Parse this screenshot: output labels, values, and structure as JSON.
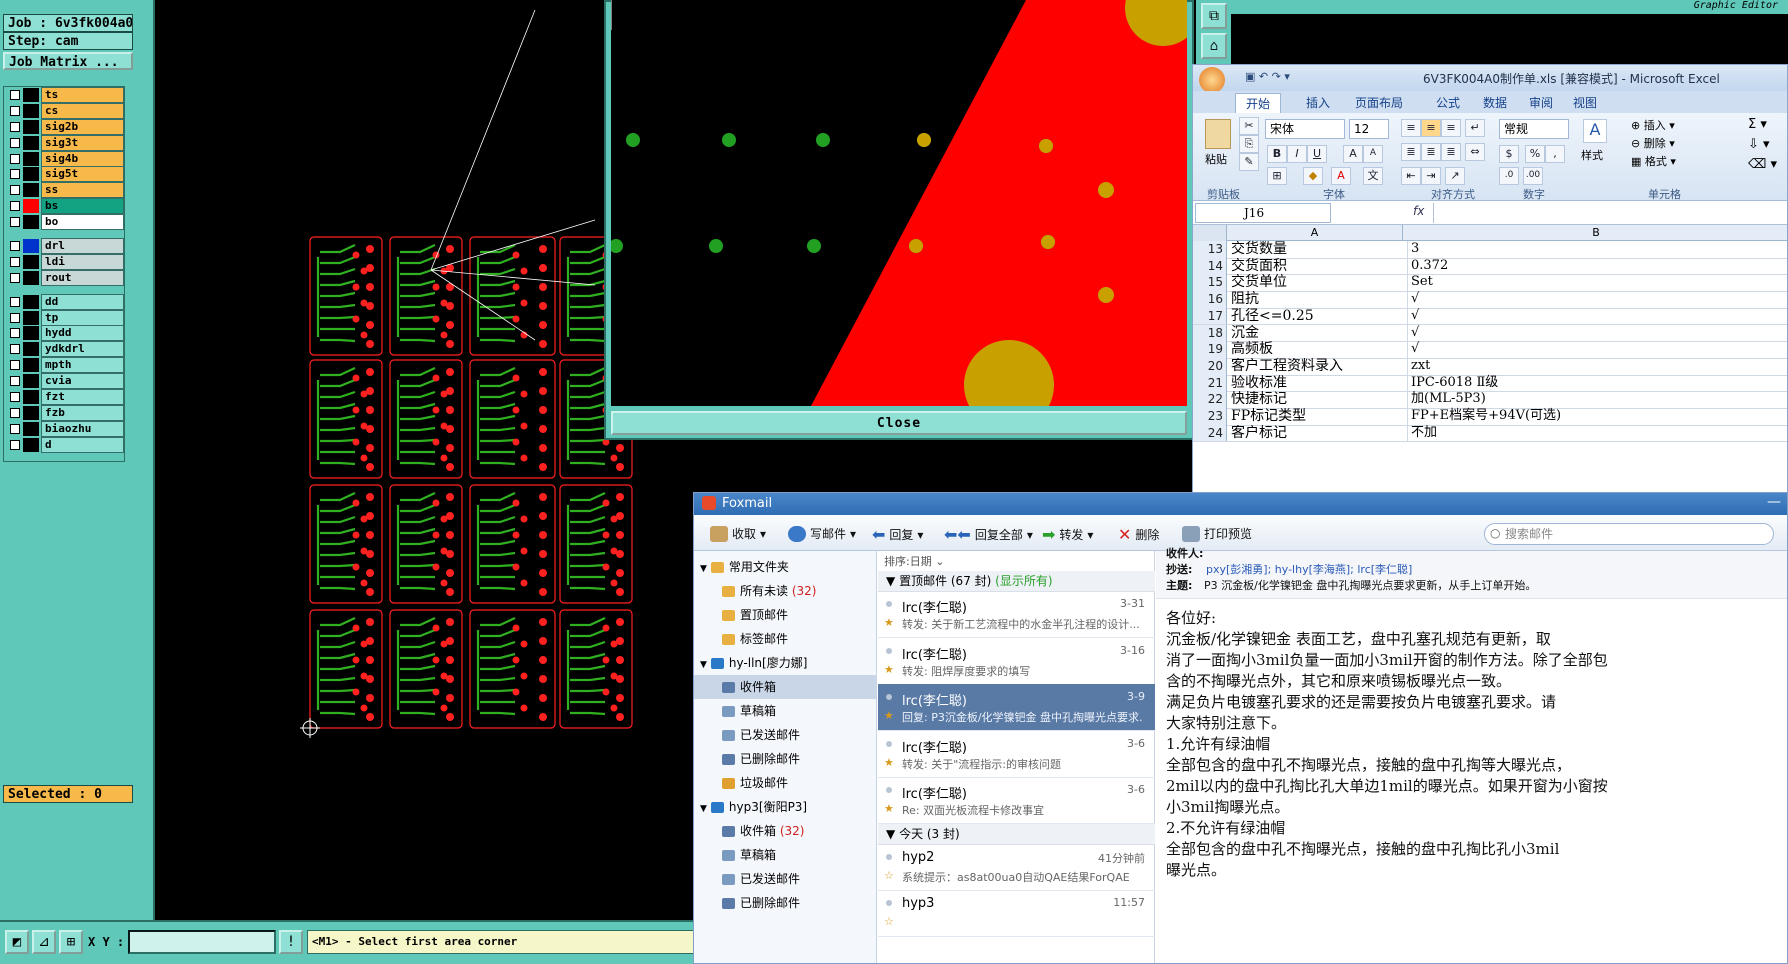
{
  "cam": {
    "job_label": "Job : 6v3fk004a0",
    "step_label": "Step: cam",
    "job_matrix": "Job Matrix ...",
    "layers_group1": [
      {
        "name": "ts",
        "color": "#f6b94a"
      },
      {
        "name": "cs",
        "color": "#f6b94a"
      },
      {
        "name": "sig2b",
        "color": "#f6b94a"
      },
      {
        "name": "sig3t",
        "color": "#f6b94a"
      },
      {
        "name": "sig4b",
        "color": "#f6b94a"
      },
      {
        "name": "sig5t",
        "color": "#f6b94a"
      },
      {
        "name": "ss",
        "color": "#f6b94a"
      },
      {
        "name": "bs",
        "color": "#13a383",
        "swatch": "#ff0000"
      },
      {
        "name": "bo",
        "color": "#ffffff"
      }
    ],
    "layers_group2": [
      {
        "name": "drl",
        "color": "#c8d8d6",
        "swatch": "#0033cc"
      },
      {
        "name": "ldi",
        "color": "#c8d8d6"
      },
      {
        "name": "rout",
        "color": "#c8d8d6"
      }
    ],
    "layers_group3": [
      {
        "name": "dd",
        "color": "#8fe0d4"
      },
      {
        "name": "tp",
        "color": "#8fe0d4"
      },
      {
        "name": "hydd",
        "color": "#8fe0d4"
      },
      {
        "name": "ydkdrl",
        "color": "#8fe0d4"
      },
      {
        "name": "mpth",
        "color": "#8fe0d4"
      },
      {
        "name": "cvia",
        "color": "#8fe0d4"
      },
      {
        "name": "fzt",
        "color": "#8fe0d4"
      },
      {
        "name": "fzb",
        "color": "#8fe0d4"
      },
      {
        "name": "biaozhu",
        "color": "#8fe0d4"
      },
      {
        "name": "d",
        "color": "#8fe0d4"
      }
    ],
    "selected": "Selected : 0",
    "xy_label": "X Y :",
    "prompt": "<M1> - Select first area corner",
    "close_label": "Close",
    "graphic_editor": "Graphic Editor"
  },
  "excel": {
    "title": "6V3FK004A0制作单.xls  [兼容模式]  -  Microsoft Excel",
    "tabs": [
      "开始",
      "插入",
      "页面布局",
      "公式",
      "数据",
      "审阅",
      "视图"
    ],
    "paste_label": "粘贴",
    "font_name": "宋体",
    "font_size": "12",
    "number_format": "常规",
    "style_label": "样式",
    "insert_label": "插入",
    "delete_label": "删除",
    "format_label": "格式",
    "groups": [
      "剪贴板",
      "字体",
      "对齐方式",
      "数字",
      "单元格"
    ],
    "name_box": "J16",
    "fx": "fx",
    "col_a": "A",
    "col_b": "B",
    "rows": [
      {
        "n": "13",
        "a": "交货数量",
        "b": "3"
      },
      {
        "n": "14",
        "a": "交货面积",
        "b": "0.372"
      },
      {
        "n": "15",
        "a": "交货单位",
        "b": "Set"
      },
      {
        "n": "16",
        "a": "阻抗",
        "b": "√"
      },
      {
        "n": "17",
        "a": "孔径<=0.25",
        "b": "√"
      },
      {
        "n": "18",
        "a": "沉金",
        "b": "√"
      },
      {
        "n": "19",
        "a": "高频板",
        "b": "√"
      },
      {
        "n": "20",
        "a": "客户工程资料录入",
        "b": "zxt"
      },
      {
        "n": "21",
        "a": "验收标准",
        "b": "IPC-6018 Ⅱ级"
      },
      {
        "n": "22",
        "a": "快捷标记",
        "b": "加(ML-5P3)"
      },
      {
        "n": "23",
        "a": "FP标记类型",
        "b": "FP+E档案号+94V(可选)"
      },
      {
        "n": "24",
        "a": "客户标记",
        "b": "不加"
      }
    ]
  },
  "foxmail": {
    "title": "Foxmail",
    "toolbar": {
      "receive": "收取",
      "compose": "写邮件",
      "reply": "回复",
      "reply_all": "回复全部",
      "forward": "转发",
      "delete": "删除",
      "print_preview": "打印预览",
      "search_placeholder": "搜索邮件"
    },
    "folders": [
      {
        "label": "常用文件夹",
        "level": 0
      },
      {
        "label": "所有未读",
        "count": "(32)",
        "level": 1
      },
      {
        "label": "置顶邮件",
        "level": 1
      },
      {
        "label": "标签邮件",
        "level": 1
      },
      {
        "label": "hy-lln[廖力娜]",
        "level": 0
      },
      {
        "label": "收件箱",
        "level": 1,
        "selected": true
      },
      {
        "label": "草稿箱",
        "level": 1
      },
      {
        "label": "已发送邮件",
        "level": 1
      },
      {
        "label": "已删除邮件",
        "level": 1
      },
      {
        "label": "垃圾邮件",
        "level": 1
      },
      {
        "label": "hyp3[衡阳P3]",
        "level": 0
      },
      {
        "label": "收件箱",
        "count": "(32)",
        "level": 1
      },
      {
        "label": "草稿箱",
        "level": 1
      },
      {
        "label": "已发送邮件",
        "level": 1
      },
      {
        "label": "已删除邮件",
        "level": 1
      }
    ],
    "sort_label": "排序:日期",
    "group_pinned": "置顶邮件 (67 封)",
    "group_pinned_show": "(显示所有)",
    "group_today": "今天 (3 封)",
    "messages": [
      {
        "from": "lrc(李仁聪)",
        "date": "3-31",
        "subject": "转发: 关于新工艺流程中的水金半孔注程的设计..."
      },
      {
        "from": "lrc(李仁聪)",
        "date": "3-16",
        "subject": "转发: 阻焊厚度要求的填写"
      },
      {
        "from": "lrc(李仁聪)",
        "date": "3-9",
        "subject": "回复: P3沉金板/化学镍钯金 盘中孔掏曝光点要求...",
        "selected": true
      },
      {
        "from": "lrc(李仁聪)",
        "date": "3-6",
        "subject": "转发: 关于\"流程指示:的审核问题"
      },
      {
        "from": "lrc(李仁聪)",
        "date": "3-6",
        "subject": "Re: 双面光板流程卡修改事宜"
      }
    ],
    "today_messages": [
      {
        "from": "hyp2",
        "date": "41分钟前",
        "subject": "系统提示：as8at00ua0自动QAE结果ForQAE"
      },
      {
        "from": "hyp3",
        "date": "11:57",
        "subject": ""
      }
    ],
    "header": {
      "recipients_label": "收件人:",
      "cc_label": "抄送:",
      "cc_value": "pxy[彭湘勇]; hy-lhy[李海燕]; lrc[李仁聪]",
      "subject_label": "主题:",
      "subject_value": "P3 沉金板/化学镍钯金 盘中孔掏曝光点要求更新，从手上订单开始。"
    },
    "body": [
      "各位好:",
      "    沉金板/化学镍钯金 表面工艺，盘中孔塞孔规范有更新，取",
      "消了一面掏小3mil负量一面加小3mil开窗的制作方法。除了全部包",
      "含的不掏曝光点外，其它和原来喷锡板曝光点一致。",
      "    满足负片电镀塞孔要求的还是需要按负片电镀塞孔要求。请",
      "大家特别注意下。",
      "1.允许有绿油帽",
      "   全部包含的盘中孔不掏曝光点，接触的盘中孔掏等大曝光点，",
      "2mil以内的盘中孔掏比孔大单边1mil的曝光点。如果开窗为小窗按",
      "小3mil掏曝光点。",
      "2.不允许有绿油帽",
      "    全部包含的盘中孔不掏曝光点，接触的盘中孔掏比孔小3mil",
      "曝光点。"
    ]
  }
}
